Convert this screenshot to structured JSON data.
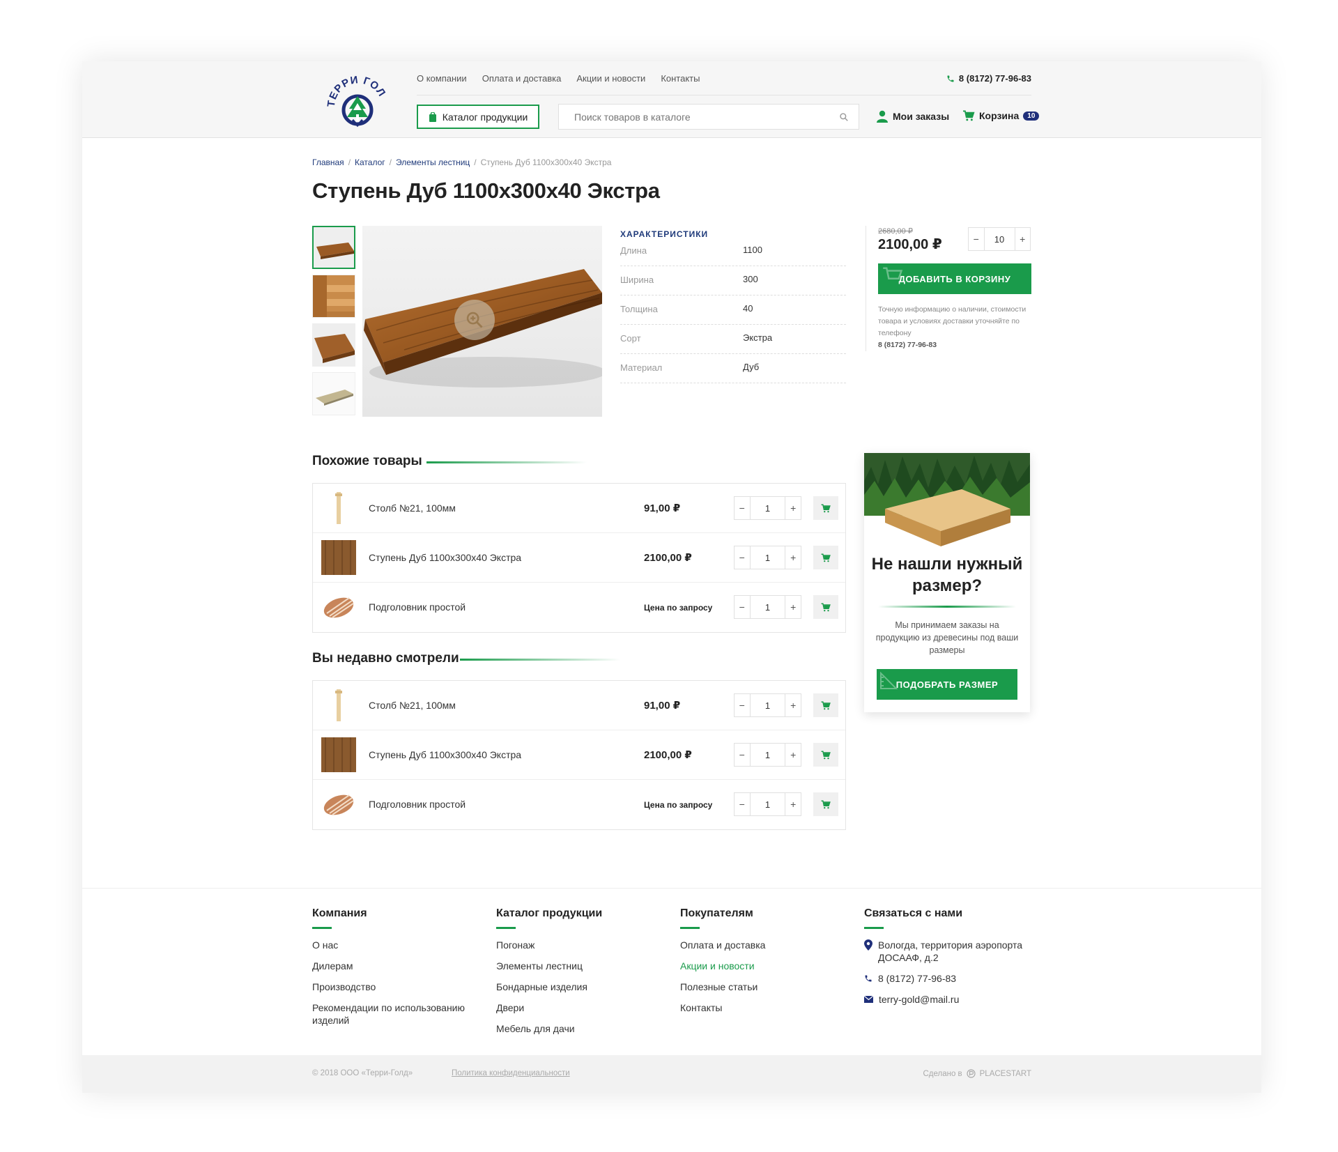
{
  "logo": {
    "text": "ТЕРРИ ГОЛД"
  },
  "nav": {
    "items": [
      "О компании",
      "Оплата и доставка",
      "Акции и новости",
      "Контакты"
    ]
  },
  "header": {
    "phone": "8 (8172) 77-96-83",
    "catalog_button": "Каталог продукции",
    "search_placeholder": "Поиск товаров в каталоге",
    "my_orders": "Мои заказы",
    "cart_label": "Корзина",
    "cart_count": "10"
  },
  "breadcrumbs": {
    "items": [
      "Главная",
      "Каталог",
      "Элементы лестниц"
    ],
    "sep": "/",
    "current": "Ступень Дуб 1100х300х40 Экстра"
  },
  "product": {
    "title": "Ступень Дуб 1100х300х40 Экстра",
    "specs_title": "ХАРАКТЕРИСТИКИ",
    "specs": [
      {
        "k": "Длина",
        "v": "1100"
      },
      {
        "k": "Ширина",
        "v": "300"
      },
      {
        "k": "Толщина",
        "v": "40"
      },
      {
        "k": "Сорт",
        "v": "Экстра"
      },
      {
        "k": "Материал",
        "v": "Дуб"
      }
    ],
    "old_price": "2680,00 ₽",
    "price": "2100,00 ₽",
    "qty": "10",
    "add_to_cart": "ДОБАВИТЬ В КОРЗИНУ",
    "note": "Точную информацию о наличии, стоимости товара и условиях доставки уточняйте по телефону",
    "note_phone": "8 (8172) 77-96-83"
  },
  "similar": {
    "title": "Похожие товары",
    "items": [
      {
        "name": "Столб №21, 100мм",
        "price": "91,00 ₽",
        "qty": "1"
      },
      {
        "name": "Ступень Дуб 1100х300х40 Экстра",
        "price": "2100,00 ₽",
        "qty": "1"
      },
      {
        "name": "Подголовник простой",
        "price": "Цена по запросу",
        "qty": "1"
      }
    ]
  },
  "recent": {
    "title": "Вы недавно смотрели",
    "items": [
      {
        "name": "Столб №21, 100мм",
        "price": "91,00 ₽",
        "qty": "1"
      },
      {
        "name": "Ступень Дуб 1100х300х40 Экстра",
        "price": "2100,00 ₽",
        "qty": "1"
      },
      {
        "name": "Подголовник простой",
        "price": "Цена по запросу",
        "qty": "1"
      }
    ]
  },
  "promo": {
    "title": "Не нашли нужный размер?",
    "text": "Мы принимаем заказы на продукцию из древесины под ваши размеры",
    "button": "ПОДОБРАТЬ РАЗМЕР"
  },
  "footer": {
    "col1": {
      "title": "Компания",
      "links": [
        "О нас",
        "Дилерам",
        "Производство",
        "Рекомендации по использованию изделий"
      ]
    },
    "col2": {
      "title": "Каталог продукции",
      "links": [
        "Погонаж",
        "Элементы лестниц",
        "Бондарные изделия",
        "Двери",
        "Мебель для дачи"
      ]
    },
    "col3": {
      "title": "Покупателям",
      "links": [
        "Оплата и доставка",
        "Акции и новости",
        "Полезные статьи",
        "Контакты"
      ]
    },
    "col4": {
      "title": "Связаться с нами",
      "address": "Вологда, территория аэропорта ДОСААФ, д.2",
      "phone": "8 (8172) 77-96-83",
      "email": "terry-gold@mail.ru"
    },
    "copyright": "© 2018 ООО «Терри-Голд»",
    "policy": "Политика конфиденциальности",
    "made_in": "Сделано в",
    "made_brand": "PLACESTART"
  },
  "colors": {
    "accent": "#1a9b4b",
    "navy": "#1f2f7a"
  }
}
